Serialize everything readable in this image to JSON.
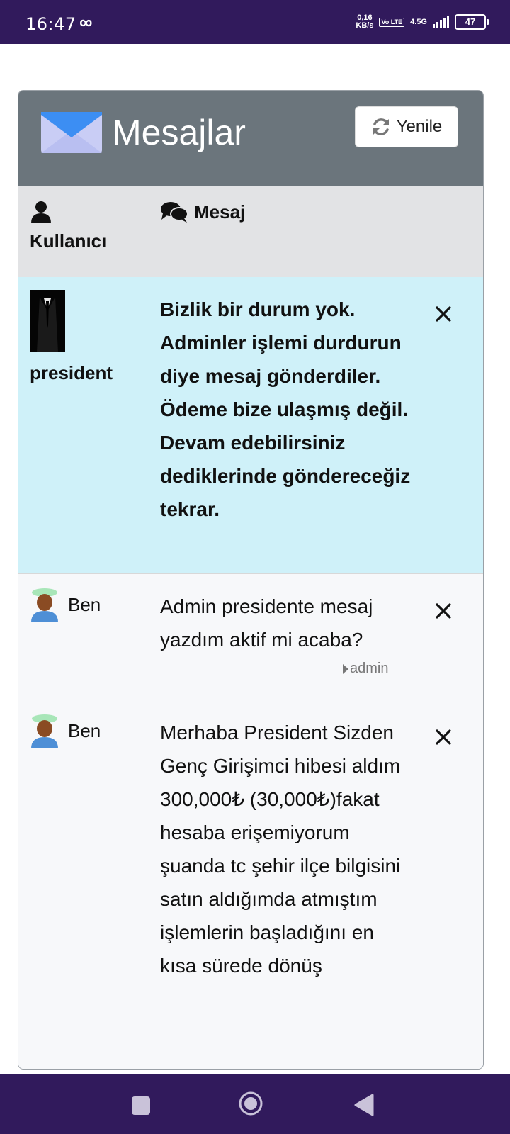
{
  "status_bar": {
    "time": "16:47",
    "speed_top": "0,16",
    "speed_unit": "KB/s",
    "volte": "Vo LTE",
    "network": "4.5G",
    "battery": "47"
  },
  "header": {
    "title": "Mesajlar",
    "refresh_label": "Yenile"
  },
  "table": {
    "col_user": "Kullanıcı",
    "col_message": "Mesaj"
  },
  "messages": [
    {
      "user": "president",
      "text": "Bizlik bir durum yok. Adminler işlemi durdurun diye mesaj gönderdiler. Ödeme bize ulaşmış değil. Devam edebilirsiniz dediklerinde göndereceğiz tekrar.",
      "bold": true
    },
    {
      "user": "Ben",
      "text": "Admin presidente mesaj yazdım aktif mi acaba?",
      "recipient": "admin"
    },
    {
      "user": "Ben",
      "text": "Merhaba President Sizden Genç Girişimci hibesi aldım 300,000₺ (30,000₺)fakat hesaba erişemiyorum şuanda tc şehir ilçe bilgisini satın aldığımda atmıştım işlemlerin başladığını en kısa sürede dönüş"
    }
  ],
  "colors": {
    "status_bar": "#311a5c",
    "card_header": "#6b757c",
    "highlight_row": "#cff1f9"
  }
}
